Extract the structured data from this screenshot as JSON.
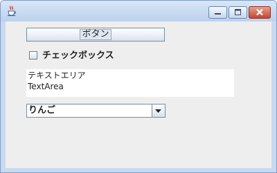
{
  "window": {
    "title": ""
  },
  "icons": {
    "app": "java-coffee-cup-icon",
    "minimize": "minimize-icon",
    "maximize": "maximize-icon",
    "close": "close-icon",
    "combo_arrow": "chevron-down-icon"
  },
  "button": {
    "label": "ボタン"
  },
  "checkbox": {
    "label": "チェックボックス",
    "checked": false
  },
  "textarea": {
    "lines": [
      "テキストエリア",
      "TextArea"
    ]
  },
  "combo": {
    "selected": "りんご"
  },
  "colors": {
    "close_button": "#c24634",
    "client_background": "#eeeeee",
    "titlebar": "#c9d9ee"
  }
}
